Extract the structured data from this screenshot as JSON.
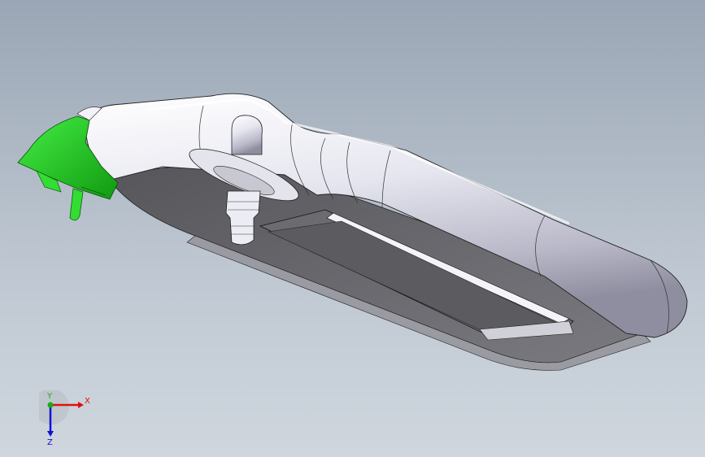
{
  "viewport": {
    "background_top": "#9aa6b5",
    "background_bottom": "#cfd6de"
  },
  "model": {
    "body_color": "#e8e8f2",
    "shadow_color": "#6e6e74",
    "highlight_part_color": "#22cc22"
  },
  "triad": {
    "x_label": "X",
    "y_label": "Y",
    "z_label": "Z",
    "x_color": "#e01010",
    "y_color": "#10b010",
    "z_color": "#1010d0"
  }
}
